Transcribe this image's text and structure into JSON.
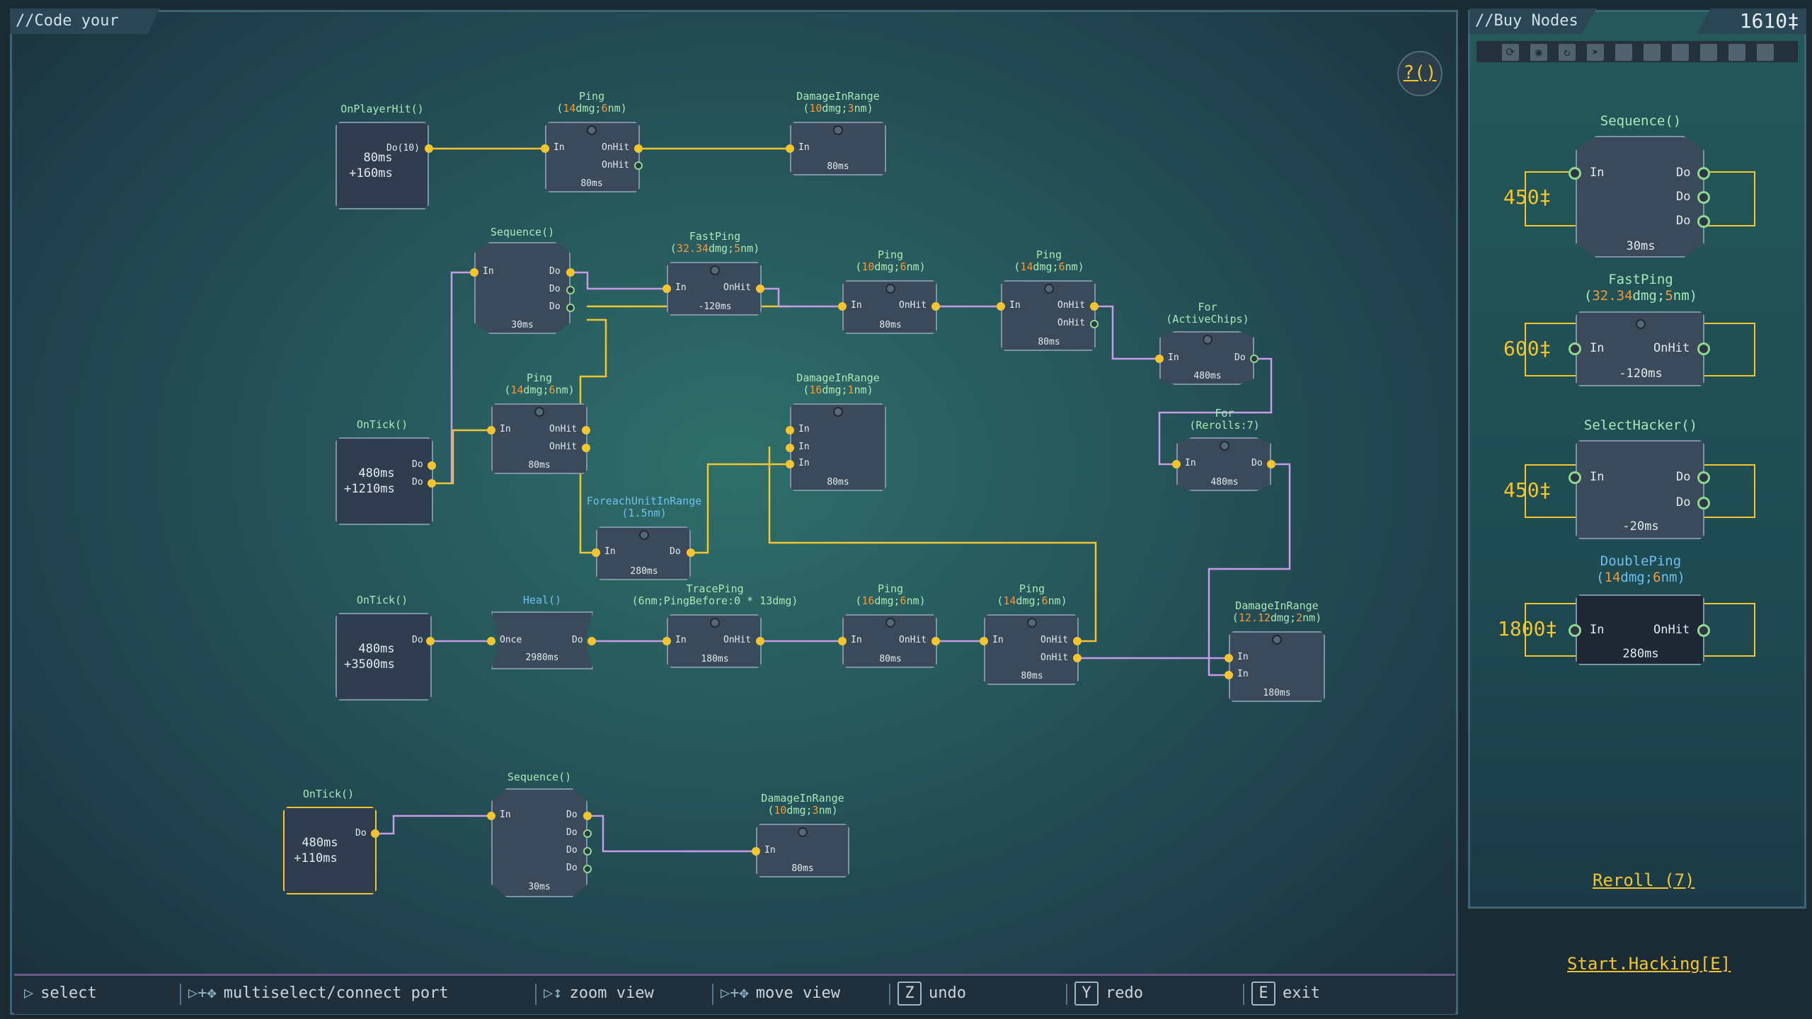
{
  "editor": {
    "title": "//Code your Virus",
    "help_label": "?()"
  },
  "shop": {
    "title": "//Buy Nodes",
    "credits": "1610‡",
    "reroll_label": "Reroll (7)",
    "items": [
      {
        "title": "Sequence()",
        "price": "450‡",
        "ports_in": [
          "In"
        ],
        "ports_out": [
          "Do",
          "Do",
          "Do"
        ],
        "cost": "30ms"
      },
      {
        "title_pre": "FastPing",
        "title_args": [
          "32.34",
          "dmg;",
          "5",
          "nm"
        ],
        "price": "600‡",
        "ports_in": [
          "In"
        ],
        "ports_out": [
          "OnHit"
        ],
        "cost": "-120ms"
      },
      {
        "title": "SelectHacker()",
        "price": "450‡",
        "ports_in": [
          "In"
        ],
        "ports_out": [
          "Do",
          "Do"
        ],
        "cost": "-20ms"
      },
      {
        "title_pre": "DoublePing",
        "title_args": [
          "14",
          "dmg;",
          "6",
          "nm"
        ],
        "price": "1800‡",
        "ports_in": [
          "In"
        ],
        "ports_out": [
          "OnHit"
        ],
        "cost": "280ms"
      }
    ]
  },
  "start_label": "Start.Hacking[E]",
  "hints": [
    {
      "icon": "mouse-left-icon",
      "label": "select"
    },
    {
      "icon": "mouse-left-drag-icon",
      "label": "multiselect/connect port"
    },
    {
      "icon": "mouse-wheel-icon",
      "label": "zoom view"
    },
    {
      "icon": "mouse-right-drag-icon",
      "label": "move view"
    },
    {
      "key": "Z",
      "label": "undo"
    },
    {
      "key": "Y",
      "label": "redo"
    },
    {
      "key": "E",
      "label": "exit"
    }
  ],
  "nodes": {
    "onplayerhit": {
      "title": "OnPlayerHit()",
      "port": "Do(10)",
      "line1": "80ms",
      "line2": "+160ms"
    },
    "ping1": {
      "title_pre": "Ping",
      "args": [
        "14",
        "dmg;",
        "6",
        "nm"
      ],
      "in": "In",
      "out1": "OnHit",
      "out2": "OnHit",
      "cost": "80ms"
    },
    "dmg1": {
      "title_pre": "DamageInRange",
      "args": [
        "10",
        "dmg;",
        "3",
        "nm"
      ],
      "in": "In",
      "cost": "80ms"
    },
    "seq1": {
      "title": "Sequence()",
      "in": "In",
      "out": [
        "Do",
        "Do",
        "Do"
      ],
      "cost": "30ms"
    },
    "fastping1": {
      "title_pre": "FastPing",
      "args": [
        "32.34",
        "dmg;",
        "5",
        "nm"
      ],
      "in": "In",
      "out1": "OnHit",
      "cost": "-120ms"
    },
    "ping2": {
      "title_pre": "Ping",
      "args": [
        "10",
        "dmg;",
        "6",
        "nm"
      ],
      "in": "In",
      "out1": "OnHit",
      "cost": "80ms"
    },
    "ping3": {
      "title_pre": "Ping",
      "args": [
        "14",
        "dmg;",
        "6",
        "nm"
      ],
      "in": "In",
      "out1": "OnHit",
      "out2": "OnHit",
      "cost": "80ms"
    },
    "for1": {
      "title": "For",
      "sub": "(ActiveChips)",
      "in": "In",
      "out": "Do",
      "cost": "480ms"
    },
    "for2": {
      "title": "For",
      "sub": "(Rerolls:7)",
      "in": "In",
      "out": "Do",
      "cost": "480ms"
    },
    "ontick1": {
      "title": "OnTick()",
      "out": [
        "Do",
        "Do"
      ],
      "line1": "480ms",
      "line2": "+1210ms"
    },
    "ping4": {
      "title_pre": "Ping",
      "args": [
        "14",
        "dmg;",
        "6",
        "nm"
      ],
      "in": "In",
      "out1": "OnHit",
      "out2": "OnHit",
      "cost": "80ms"
    },
    "dmg2": {
      "title_pre": "DamageInRange",
      "args": [
        "16",
        "dmg;",
        "1",
        "nm"
      ],
      "in": [
        "In",
        "In",
        "In"
      ],
      "cost": "80ms"
    },
    "foreach": {
      "title": "ForeachUnitInRange",
      "sub": "(1.5nm)",
      "in": "In",
      "out": "Do",
      "cost": "280ms"
    },
    "ontick2": {
      "title": "OnTick()",
      "out": "Do",
      "line1": "480ms",
      "line2": "+3500ms"
    },
    "heal": {
      "title": "Heal()",
      "in": "Once",
      "out": "Do",
      "cost": "2980ms"
    },
    "traceping": {
      "title_pre": "TracePing",
      "args_text": "(6nm;PingBefore:0 * 13dmg)",
      "in": "In",
      "out1": "OnHit",
      "cost": "180ms"
    },
    "ping5": {
      "title_pre": "Ping",
      "args": [
        "16",
        "dmg;",
        "6",
        "nm"
      ],
      "in": "In",
      "out1": "OnHit",
      "cost": "80ms"
    },
    "ping6": {
      "title_pre": "Ping",
      "args": [
        "14",
        "dmg;",
        "6",
        "nm"
      ],
      "in": "In",
      "out1": "OnHit",
      "out2": "OnHit",
      "cost": "80ms"
    },
    "dmg3": {
      "title_pre": "DamageInRange",
      "args": [
        "12.12",
        "dmg;",
        "2",
        "nm"
      ],
      "in": [
        "In",
        "In"
      ],
      "cost": "180ms"
    },
    "ontick3": {
      "title": "OnTick()",
      "out": "Do",
      "line1": "480ms",
      "line2": "+110ms"
    },
    "seq2": {
      "title": "Sequence()",
      "in": "In",
      "out": [
        "Do",
        "Do",
        "Do",
        "Do"
      ],
      "cost": "30ms"
    },
    "dmg4": {
      "title_pre": "DamageInRange",
      "args": [
        "10",
        "dmg;",
        "3",
        "nm"
      ],
      "in": "In",
      "cost": "80ms"
    }
  },
  "colors": {
    "accent": "#f2c531",
    "wire_yellow": "#f2c531",
    "wire_purple": "#c79be8",
    "title_green": "#a9e8b8",
    "title_blue": "#6fc0ee",
    "arg_orange": "#f29a3a"
  }
}
